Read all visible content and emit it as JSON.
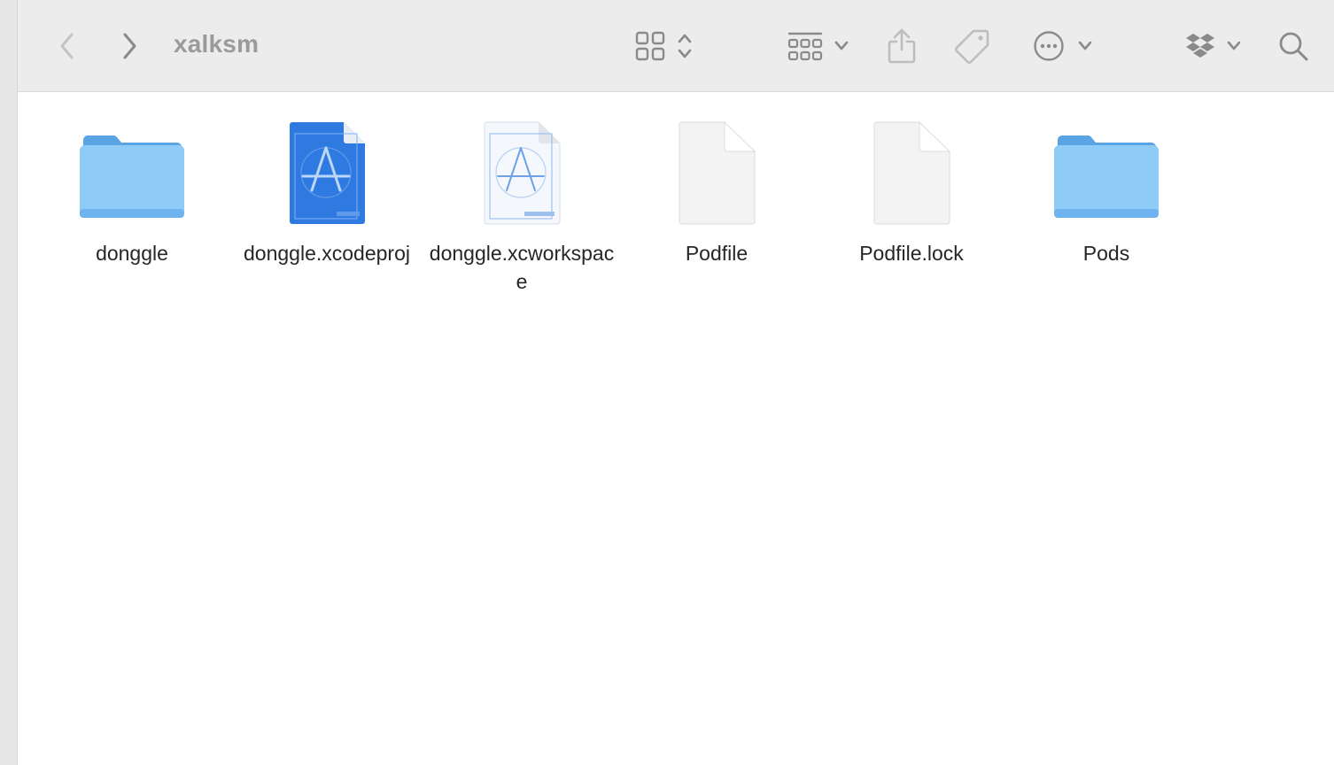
{
  "window": {
    "title": "xalksm"
  },
  "toolbar": {
    "back_icon": "chevron-left-icon",
    "forward_icon": "chevron-right-icon",
    "view_icon": "grid-view-icon",
    "group_icon": "group-icon",
    "share_icon": "share-icon",
    "tag_icon": "tag-icon",
    "more_icon": "ellipsis-circle-icon",
    "dropbox_icon": "dropbox-icon",
    "search_icon": "search-icon"
  },
  "files": [
    {
      "name": "donggle",
      "kind": "folder"
    },
    {
      "name": "donggle.xcodeproj",
      "kind": "xcodeproj"
    },
    {
      "name": "donggle.xcworkspace",
      "kind": "xcworkspace"
    },
    {
      "name": "Podfile",
      "kind": "document"
    },
    {
      "name": "Podfile.lock",
      "kind": "document"
    },
    {
      "name": "Pods",
      "kind": "folder"
    }
  ],
  "colors": {
    "folder_body": "#8ecbf6",
    "folder_tab": "#5aa4e4",
    "xcodeproj_blue": "#2f7ae0",
    "toolbar_bg": "#ececec",
    "icon_gray": "#a6a6a6"
  }
}
